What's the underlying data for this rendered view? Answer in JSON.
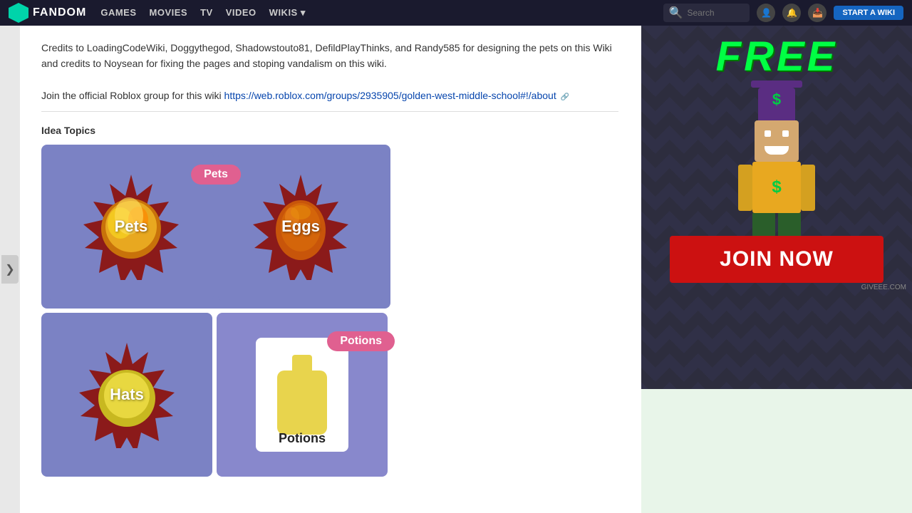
{
  "nav": {
    "logo_text": "FANDOM",
    "links": [
      "GAMES",
      "MOVIES",
      "TV",
      "VIDEO",
      "WIKIS ▾"
    ],
    "search_placeholder": "Search",
    "start_wiki_btn": "START A WIKI"
  },
  "content": {
    "credits_paragraph": "Credits to LoadingCodeWiki, Doggythegod, Shadowstouto81, DefildPlayThinks, and Randy585 for designing the pets on this Wiki and credits to Noysean for fixing the pages and stoping vandalism on this wiki.",
    "join_group_text": "Join the official Roblox group for this wiki ",
    "join_group_url": "https://web.roblox.com/groups/2935905/golden-west-middle-school#!/about",
    "idea_topics_title": "Idea Topics",
    "topics": [
      {
        "id": "pets",
        "label": "Pets",
        "badge": "Pets",
        "type": "fire"
      },
      {
        "id": "eggs",
        "label": "Eggs",
        "type": "egg"
      },
      {
        "id": "hats",
        "label": "Hats",
        "type": "star"
      },
      {
        "id": "potions",
        "label": "Potions",
        "badge": "Potions",
        "type": "bottle"
      }
    ]
  },
  "ad": {
    "free_text": "FREE",
    "join_btn": "JOIN NOW",
    "watermark": "GIVEEE.COM"
  },
  "left_toggle": "❯"
}
